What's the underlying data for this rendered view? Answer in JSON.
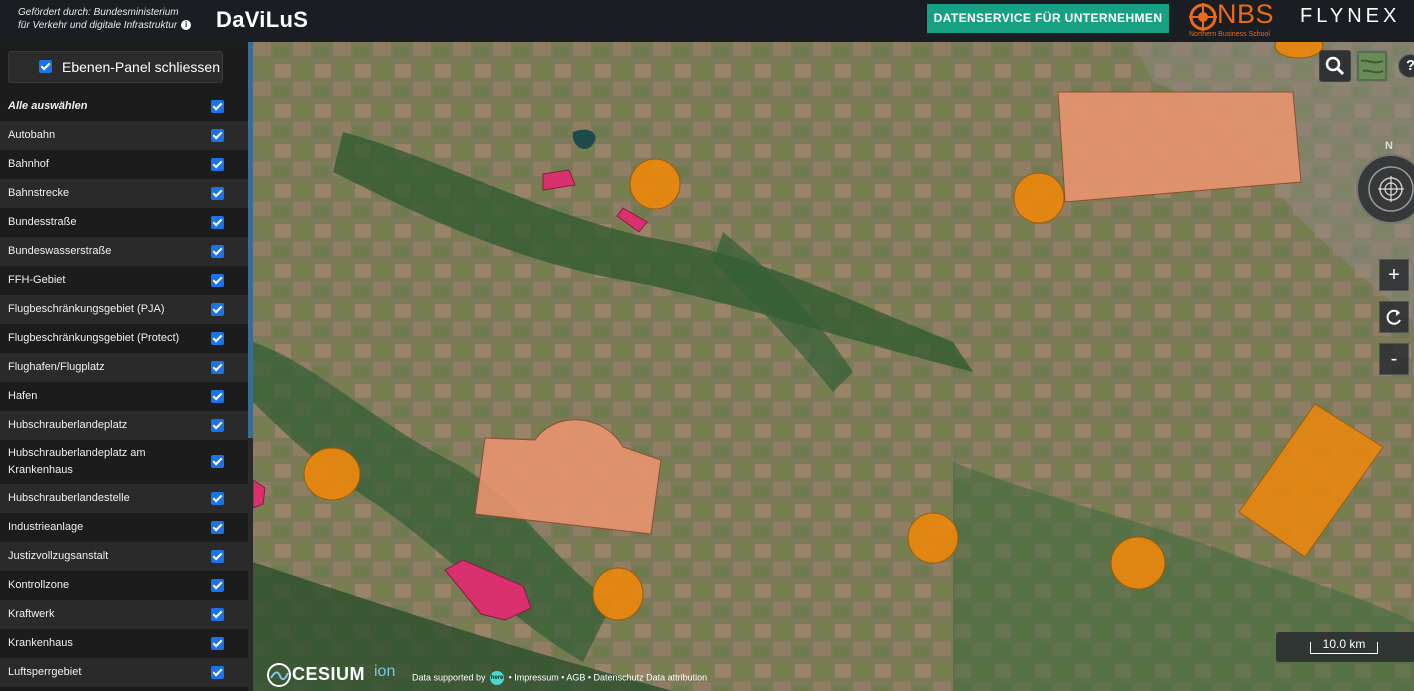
{
  "header": {
    "funding_line1": "Gefördert durch: Bundesministerium",
    "funding_line2": "für Verkehr und digitale Infrastruktur",
    "info_icon": "info-icon",
    "app_title": "DaViLuS",
    "datenservice_label": "DATENSERVICE FÜR UNTERNEHMEN",
    "nbs_text": "NBS",
    "nbs_subtitle": "Northern Business School",
    "flynex_text": "FLYNEX"
  },
  "sidebar": {
    "panel_toggle_label": "Ebenen-Panel schliessen",
    "select_all_label": "Alle auswählen",
    "layers": [
      "Autobahn",
      "Bahnhof",
      "Bahnstrecke",
      "Bundesstraße",
      "Bundeswasserstraße",
      "FFH-Gebiet",
      "Flugbeschränkungsgebiet (PJA)",
      "Flugbeschränkungsgebiet (Protect)",
      "Flughafen/Flugplatz",
      "Hafen",
      "Hubschrauberlandeplatz",
      "Hubschrauberlandeplatz am Krankenhaus",
      "Hubschrauberlandestelle",
      "Industrieanlage",
      "Justizvollzugsanstalt",
      "Kontrollzone",
      "Kraftwerk",
      "Krankenhaus",
      "Luftsperrgebiet"
    ]
  },
  "map": {
    "scale_label": "10.0 km",
    "zoom_in_label": "+",
    "zoom_out_label": "-",
    "compass_label": "N",
    "help_label": "?",
    "cesium_label": "CESIUM",
    "cesium_ion_label": "ion",
    "attribution_prefix": "Data supported by",
    "here_label": "here",
    "attribution_suffix": "• Impressum • AGB • Datenschutz  Data attribution",
    "colors": {
      "zone_salmon": "#e8946e",
      "zone_orange": "#e8870f",
      "zone_pink": "#d8316e"
    }
  }
}
